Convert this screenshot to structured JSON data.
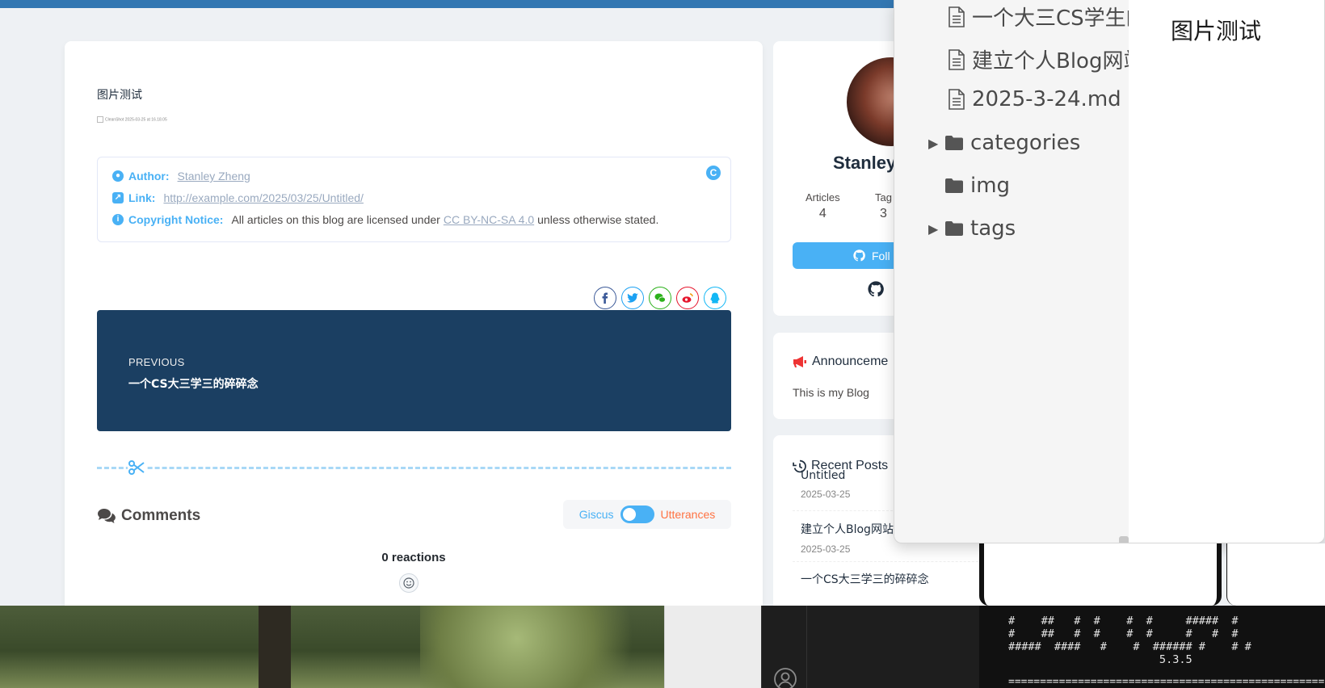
{
  "post": {
    "body_text": "图片测试",
    "broken_image_alt": "CleanShot 2025-03-25 at 16.18.05",
    "copyright": {
      "author_label": "Author:",
      "author_value": "Stanley Zheng",
      "link_label": "Link:",
      "link_value": "http://example.com/2025/03/25/Untitled/",
      "notice_label": "Copyright Notice:",
      "notice_text_before": "All articles on this blog are licensed under",
      "license_link": "CC BY-NC-SA 4.0",
      "notice_text_after": "unless otherwise stated.",
      "badge": "C"
    },
    "share_icons": [
      {
        "name": "facebook-icon",
        "color": "#3b5998"
      },
      {
        "name": "twitter-icon",
        "color": "#1da1f2"
      },
      {
        "name": "wechat-icon",
        "color": "#2cb11b"
      },
      {
        "name": "weibo-icon",
        "color": "#e6162d"
      },
      {
        "name": "qq-icon",
        "color": "#12b7f5"
      }
    ],
    "previous": {
      "label": "PREVIOUS",
      "title": "一个CS大三学三的碎碎念"
    },
    "comments": {
      "heading": "Comments",
      "switch_left": "Giscus",
      "switch_right": "Utterances",
      "reactions": "0 reactions"
    }
  },
  "sidebar": {
    "author_name": "Stanley",
    "stats": [
      {
        "label": "Articles",
        "value": "4"
      },
      {
        "label": "Tag",
        "value": "3"
      }
    ],
    "follow_label": "Foll",
    "announcement_title": "Announceme",
    "announcement_text": "This is my Blog",
    "recent_title": "Recent Posts",
    "recent_posts": [
      {
        "title": "Untitled",
        "date": "2025-03-25"
      },
      {
        "title": "建立个人Blog网站",
        "date": "2025-03-25"
      },
      {
        "title": "一个CS大三学三的碎碎念",
        "date": ""
      }
    ]
  },
  "file_tree": {
    "items": [
      {
        "type": "file",
        "label": "一个大三CS学生的"
      },
      {
        "type": "file",
        "label": "建立个人Blog网站"
      },
      {
        "type": "file",
        "label": "2025-3-24.md"
      },
      {
        "type": "folder",
        "label": "categories",
        "collapsible": true
      },
      {
        "type": "folder",
        "label": "img",
        "collapsible": false
      },
      {
        "type": "folder",
        "label": "tags",
        "collapsible": true
      }
    ],
    "preview_title": "图片测试"
  },
  "terminal": {
    "ascii_lines": [
      "#    ##   #  #    #  #     #####  #",
      "#    ##   #  #    #  #     #   #  #",
      "#####  ####   #    #  ###### #    # #",
      "                       5.3.5"
    ],
    "rule": "=================================================="
  },
  "colors": {
    "accent": "#49b1f5",
    "top_bar": "#3377b2",
    "previous_bg": "#1b3f62",
    "utterances": "#ff7242"
  }
}
